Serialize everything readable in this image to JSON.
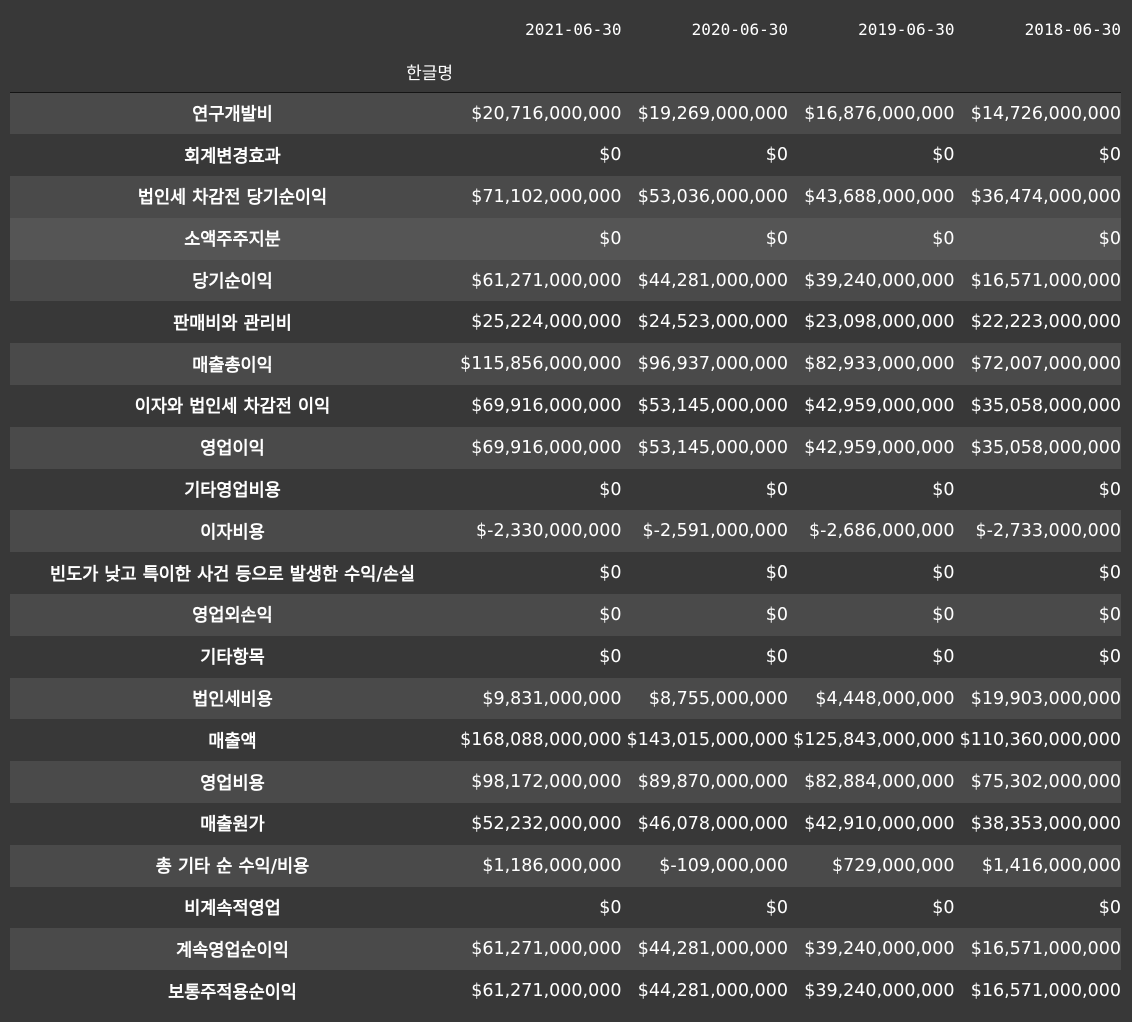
{
  "table": {
    "index_name": "한글명",
    "columns": [
      "2021-06-30",
      "2020-06-30",
      "2019-06-30",
      "2018-06-30"
    ],
    "rows": [
      {
        "label": "연구개발비",
        "values": [
          "$20,716,000,000",
          "$19,269,000,000",
          "$16,876,000,000",
          "$14,726,000,000"
        ]
      },
      {
        "label": "회계변경효과",
        "values": [
          "$0",
          "$0",
          "$0",
          "$0"
        ]
      },
      {
        "label": "법인세 차감전 당기순이익",
        "values": [
          "$71,102,000,000",
          "$53,036,000,000",
          "$43,688,000,000",
          "$36,474,000,000"
        ]
      },
      {
        "label": "소액주주지분",
        "values": [
          "$0",
          "$0",
          "$0",
          "$0"
        ]
      },
      {
        "label": "당기순이익",
        "values": [
          "$61,271,000,000",
          "$44,281,000,000",
          "$39,240,000,000",
          "$16,571,000,000"
        ]
      },
      {
        "label": "판매비와 관리비",
        "values": [
          "$25,224,000,000",
          "$24,523,000,000",
          "$23,098,000,000",
          "$22,223,000,000"
        ]
      },
      {
        "label": "매출총이익",
        "values": [
          "$115,856,000,000",
          "$96,937,000,000",
          "$82,933,000,000",
          "$72,007,000,000"
        ]
      },
      {
        "label": "이자와 법인세 차감전 이익",
        "values": [
          "$69,916,000,000",
          "$53,145,000,000",
          "$42,959,000,000",
          "$35,058,000,000"
        ]
      },
      {
        "label": "영업이익",
        "values": [
          "$69,916,000,000",
          "$53,145,000,000",
          "$42,959,000,000",
          "$35,058,000,000"
        ]
      },
      {
        "label": "기타영업비용",
        "values": [
          "$0",
          "$0",
          "$0",
          "$0"
        ]
      },
      {
        "label": "이자비용",
        "values": [
          "$-2,330,000,000",
          "$-2,591,000,000",
          "$-2,686,000,000",
          "$-2,733,000,000"
        ]
      },
      {
        "label": "빈도가 낮고 특이한 사건 등으로 발생한 수익/손실",
        "values": [
          "$0",
          "$0",
          "$0",
          "$0"
        ]
      },
      {
        "label": "영업외손익",
        "values": [
          "$0",
          "$0",
          "$0",
          "$0"
        ]
      },
      {
        "label": "기타항목",
        "values": [
          "$0",
          "$0",
          "$0",
          "$0"
        ]
      },
      {
        "label": "법인세비용",
        "values": [
          "$9,831,000,000",
          "$8,755,000,000",
          "$4,448,000,000",
          "$19,903,000,000"
        ]
      },
      {
        "label": "매출액",
        "values": [
          "$168,088,000,000",
          "$143,015,000,000",
          "$125,843,000,000",
          "$110,360,000,000"
        ]
      },
      {
        "label": "영업비용",
        "values": [
          "$98,172,000,000",
          "$89,870,000,000",
          "$82,884,000,000",
          "$75,302,000,000"
        ]
      },
      {
        "label": "매출원가",
        "values": [
          "$52,232,000,000",
          "$46,078,000,000",
          "$42,910,000,000",
          "$38,353,000,000"
        ]
      },
      {
        "label": "총 기타 순 수익/비용",
        "values": [
          "$1,186,000,000",
          "$-109,000,000",
          "$729,000,000",
          "$1,416,000,000"
        ]
      },
      {
        "label": "비계속적영업",
        "values": [
          "$0",
          "$0",
          "$0",
          "$0"
        ]
      },
      {
        "label": "계속영업순이익",
        "values": [
          "$61,271,000,000",
          "$44,281,000,000",
          "$39,240,000,000",
          "$16,571,000,000"
        ]
      },
      {
        "label": "보통주적용순이익",
        "values": [
          "$61,271,000,000",
          "$44,281,000,000",
          "$39,240,000,000",
          "$16,571,000,000"
        ]
      }
    ]
  }
}
